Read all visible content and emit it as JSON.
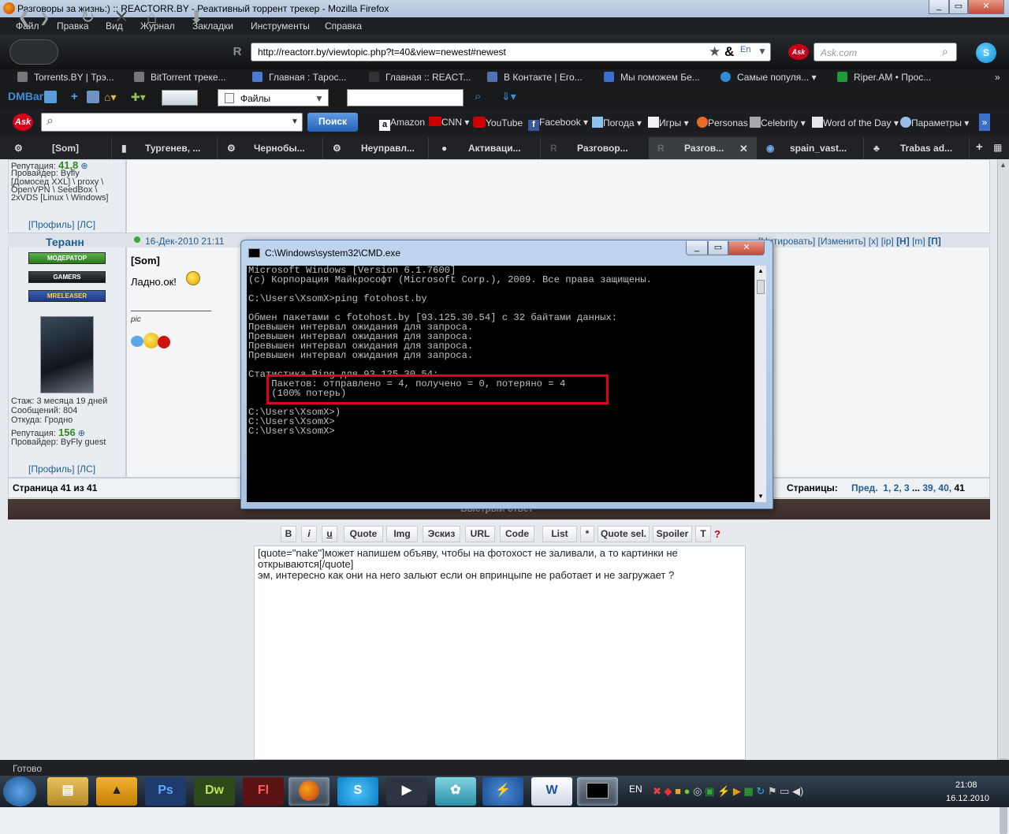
{
  "window": {
    "title": "Разговоры за жизнь:) :: REACTORR.BY - Реактивный торрент трекер - Mozilla Firefox"
  },
  "menu": [
    "Файл",
    "Правка",
    "Вид",
    "Журнал",
    "Закладки",
    "Инструменты",
    "Справка"
  ],
  "nav": {
    "url": "http://reactorr.by/viewtopic.php?t=40&view=newest#newest",
    "search_placeholder": "Ask.com"
  },
  "bookmarks": [
    {
      "label": "Torrents.BY | Трэ...",
      "color": "#777"
    },
    {
      "label": "BitTorrent треке...",
      "color": "#777"
    },
    {
      "label": "Главная : Таpoc...",
      "color": "#4a7ad4"
    },
    {
      "label": "Главная :: REACT...",
      "color": "#333"
    },
    {
      "label": "В Контакте | Его...",
      "color": "#4b73b5"
    },
    {
      "label": "Мы поможем Бе...",
      "color": "#3a6fd1"
    },
    {
      "label": "Самые популя...",
      "color": "#2b8dd6"
    },
    {
      "label": "Riper.AM • Прос...",
      "color": "#1e9a3c"
    }
  ],
  "dmbar": {
    "logo": "DMBar",
    "select": "Файлы"
  },
  "askbar": {
    "search_button": "Поиск",
    "links": [
      "Amazon",
      "CNN",
      "YouTube",
      "Facebook",
      "Погода",
      "Игры",
      "Personas",
      "Celebrity",
      "Word of the Day",
      "Параметры"
    ]
  },
  "tabs": [
    "[Som]",
    "Тургенев, ...",
    "Чернобы...",
    "Неуправл...",
    "Активаци...",
    "Разговор...",
    "Разгов...",
    "spain_vast...",
    "Trabas ad..."
  ],
  "post1": {
    "reputation_label": "Репутация:",
    "reputation": "41,8",
    "provider_label": "Провайдер:",
    "provider_lines": [
      "Byfly",
      "[Домосед XXL] \\ proxy \\",
      "OpenVPN \\ SeedBox \\",
      "2xVDS [Linux \\ Windows]"
    ],
    "profile": "[Профиль]",
    "pm": "[ЛС]"
  },
  "post2": {
    "author": "Теранн",
    "badges": [
      "МОДЕРАТОР",
      "GAMERS",
      "MRELEASER"
    ],
    "date": "16-Дек-2010 21:11",
    "actions": [
      "[Цитировать]",
      "[Изменить]",
      "[x]",
      "[ip]",
      "[H]",
      "[m]",
      "[П]"
    ],
    "body_quote": "[Som]",
    "body_text": "Ладно.ок!",
    "signature": "pic",
    "stats": [
      {
        "label": "Стаж:",
        "value": "3 месяца 19 дней"
      },
      {
        "label": "Сообщений:",
        "value": "804"
      },
      {
        "label": "Откуда:",
        "value": "Гродно"
      }
    ],
    "reputation_label": "Репутация:",
    "reputation": "156",
    "provider_label": "Провайдер:",
    "provider": "ByFly guest",
    "profile": "[Профиль]",
    "pm": "[ЛС]"
  },
  "pagination": {
    "left": "Страница 41 из 41",
    "label": "Страницы:",
    "prev": "Пред.",
    "pages": [
      "1",
      "2",
      "3",
      "...",
      "39",
      "40",
      "41"
    ]
  },
  "quick_reply": {
    "header": "Быстрый ответ",
    "buttons": [
      "B",
      "i",
      "u",
      "Quote",
      "Img",
      "Эскиз",
      "URL",
      "Code",
      "List",
      "*",
      "Quote sel.",
      "Spoiler",
      "T",
      "?"
    ],
    "text_lines": [
      "[quote=\"nake\"]может напишем объяву, чтобы на фотохост не заливали, а то картинки не",
      "открываются[/quote]",
      "эм, интересно как они на него зальют если он впринцыпе не работает и не загружает ?"
    ]
  },
  "cmd": {
    "title": "C:\\Windows\\system32\\CMD.exe",
    "lines": [
      "Microsoft Windows [Version 6.1.7600]",
      "(c) Корпорация Майкрософт (Microsoft Corp.), 2009. Все права защищены.",
      "",
      "C:\\Users\\XsomX>ping fotohost.by",
      "",
      "Обмен пакетами с fotohost.by [93.125.30.54] с 32 байтами данных:",
      "Превышен интервал ожидания для запроса.",
      "Превышен интервал ожидания для запроса.",
      "Превышен интервал ожидания для запроса.",
      "Превышен интервал ожидания для запроса.",
      "",
      "Статистика Ping для 93.125.30.54:",
      "    Пакетов: отправлено = 4, получено = 0, потеряно = 4",
      "    (100% потерь)",
      "",
      "C:\\Users\\XsomX>)",
      "C:\\Users\\XsomX>",
      "C:\\Users\\XsomX>"
    ]
  },
  "status": "Готово",
  "taskbar": {
    "lang": "EN",
    "time": "21:08",
    "date": "16.12.2010"
  }
}
